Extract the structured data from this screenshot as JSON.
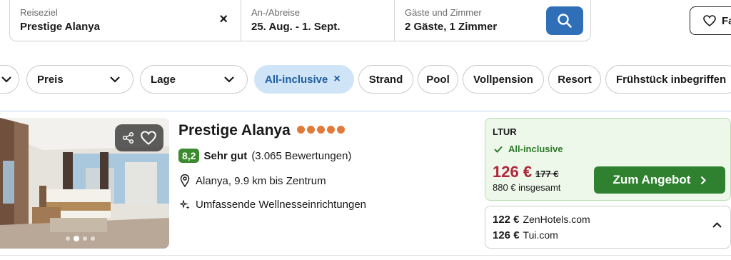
{
  "search": {
    "destination": {
      "label": "Reiseziel",
      "value": "Prestige Alanya"
    },
    "dates": {
      "label": "An-/Abreise",
      "value": "25. Aug. - 1. Sept."
    },
    "guests": {
      "label": "Gäste und Zimmer",
      "value": "2 Gäste, 1 Zimmer"
    },
    "clear_glyph": "×",
    "button_color": "#2f6fb8"
  },
  "favorites": {
    "label": "Fa"
  },
  "filters": {
    "chips": [
      {
        "label": "Preis"
      },
      {
        "label": "Lage"
      },
      {
        "label": "All-inclusive",
        "active": true
      },
      {
        "label": "Strand"
      },
      {
        "label": "Pool"
      },
      {
        "label": "Vollpension"
      },
      {
        "label": "Resort"
      },
      {
        "label": "Frühstück inbegriffen"
      }
    ],
    "remove_glyph": "×"
  },
  "hotel": {
    "name": "Prestige Alanya",
    "stars": 5,
    "rating": {
      "score": "8,2",
      "word": "Sehr gut",
      "count": "(3.065 Bewertungen)"
    },
    "location": "Alanya, 9.9 km bis Zentrum",
    "amenity": "Umfassende Wellnesseinrichtungen",
    "photo_count_dots": 4,
    "photo_active_dot": 1
  },
  "offer": {
    "provider": "LTUR",
    "inclusion": "All-inclusive",
    "price": "126 €",
    "old_price": "177 €",
    "total": "880 € insgesamt",
    "cta": "Zum Angebot",
    "accent_color": "#2f8130",
    "price_color": "#b2263a"
  },
  "other_offers": [
    {
      "price": "122 €",
      "provider": "ZenHotels.com"
    },
    {
      "price": "126 €",
      "provider": "Tui.com"
    }
  ]
}
